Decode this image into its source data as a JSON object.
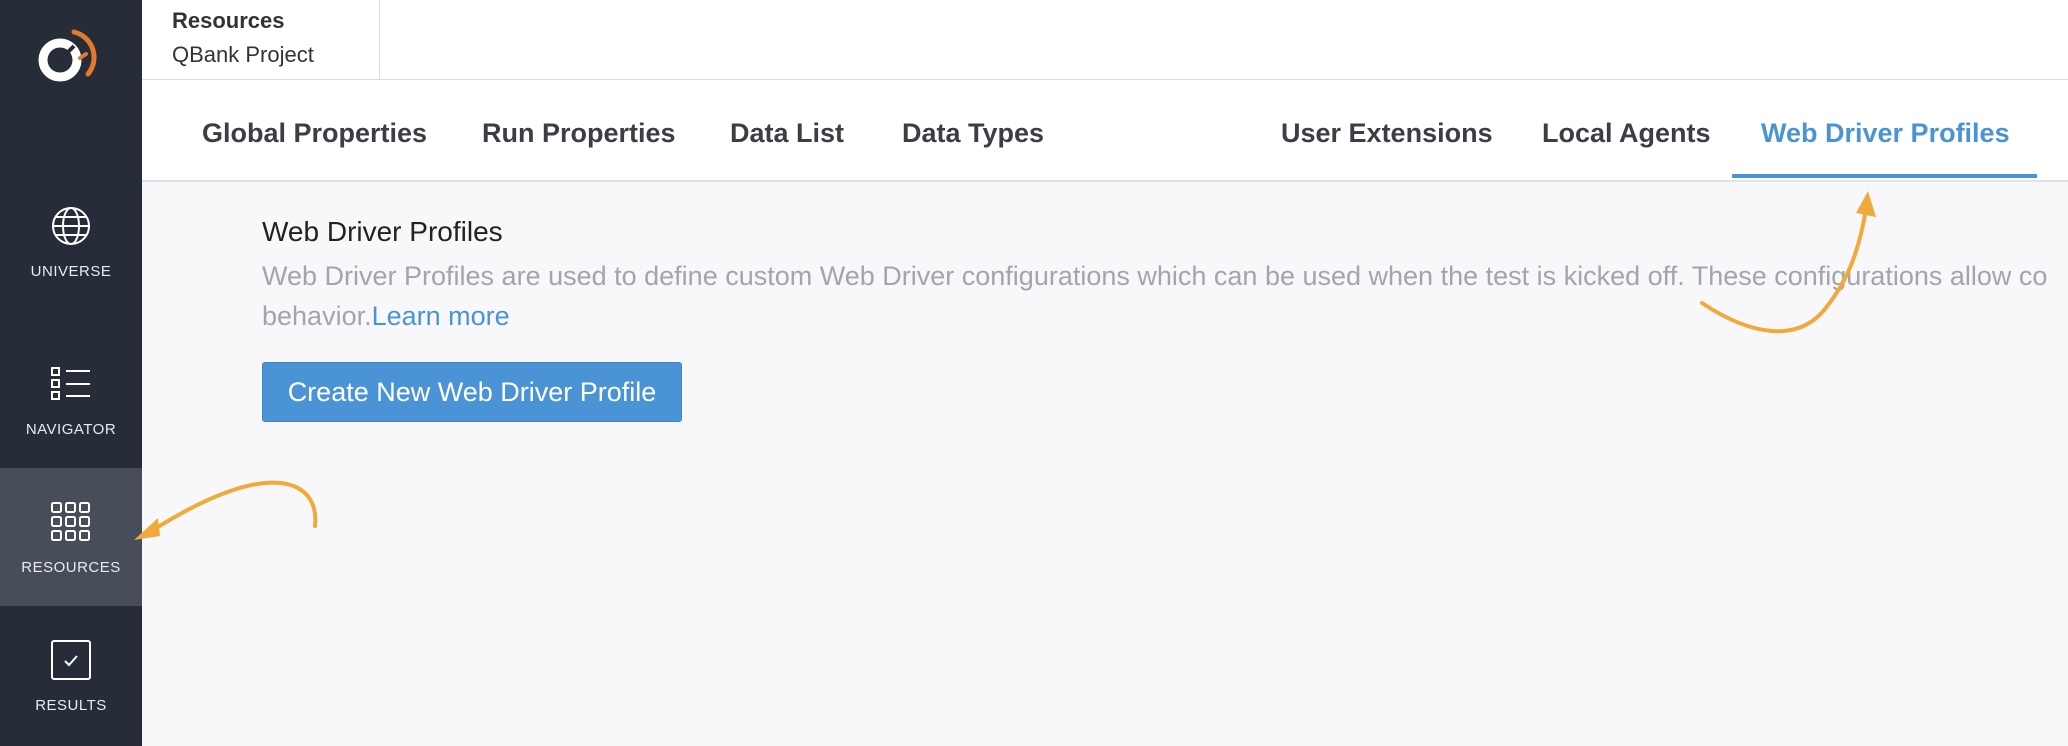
{
  "sidebar": {
    "items": [
      {
        "label": "UNIVERSE",
        "icon": "globe-icon"
      },
      {
        "label": "NAVIGATOR",
        "icon": "list-icon"
      },
      {
        "label": "RESOURCES",
        "icon": "grid-icon",
        "active": true
      },
      {
        "label": "RESULTS",
        "icon": "checkbox-icon"
      }
    ]
  },
  "breadcrumb": {
    "section": "Resources",
    "project": "QBank Project"
  },
  "tabs": [
    {
      "label": "Global Properties"
    },
    {
      "label": "Run Properties"
    },
    {
      "label": "Data List"
    },
    {
      "label": "Data Types"
    },
    {
      "label": "User Extensions"
    },
    {
      "label": "Local Agents"
    },
    {
      "label": "Web Driver Profiles",
      "active": true
    }
  ],
  "main": {
    "title": "Web Driver Profiles",
    "description_line1": "Web Driver Profiles are used to define custom Web Driver configurations which can be used when the test is kicked off. These configurations allow co",
    "description_line2": "behavior.",
    "learn_more": "Learn more",
    "create_button": "Create New Web Driver Profile"
  },
  "colors": {
    "sidebar_bg": "#262c38",
    "sidebar_active": "#474d59",
    "accent": "#4a94d6",
    "annotation_arrow": "#f0a93a",
    "logo_orange": "#e07b2d"
  }
}
